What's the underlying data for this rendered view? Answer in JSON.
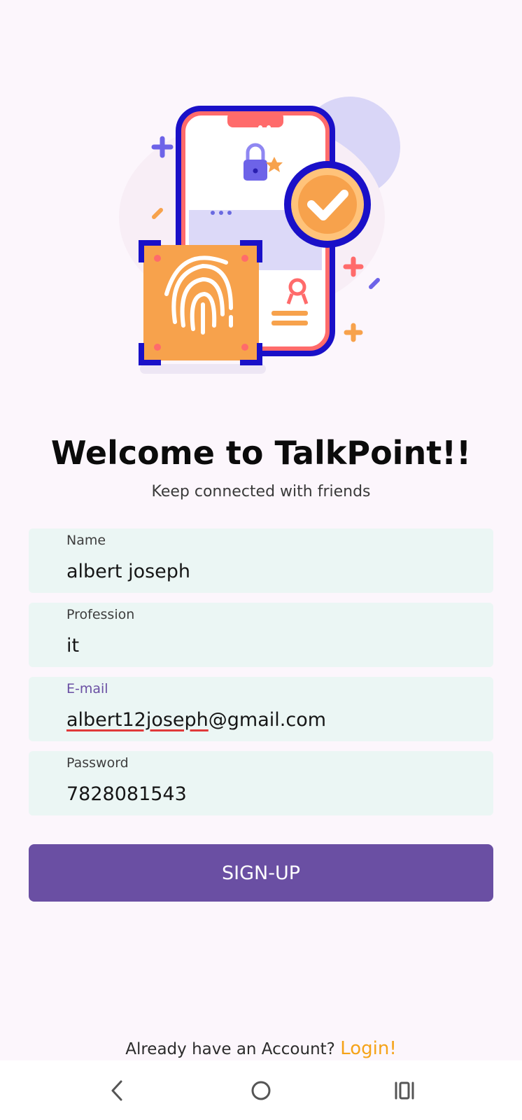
{
  "header": {
    "title": "Welcome to TalkPoint!!",
    "subtitle": "Keep connected with friends"
  },
  "form": {
    "name": {
      "label": "Name",
      "value": "albert joseph"
    },
    "profession": {
      "label": "Profession",
      "value": "it"
    },
    "email": {
      "label": "E-mail",
      "value_underlined": "albert12joseph",
      "value_rest": "@gmail.com"
    },
    "password": {
      "label": "Password",
      "value": "7828081543"
    }
  },
  "signup_button": {
    "label": "SIGN-UP"
  },
  "footer": {
    "prompt": "Already have an Account?",
    "login_link": "Login!"
  },
  "navbar": {
    "back_icon": "back-icon",
    "home_icon": "home-icon",
    "recents_icon": "recents-icon"
  },
  "colors": {
    "background": "#FCF6FC",
    "field_background": "#EBF6F4",
    "primary": "#6A4FA3",
    "accent": "#F5A318"
  }
}
